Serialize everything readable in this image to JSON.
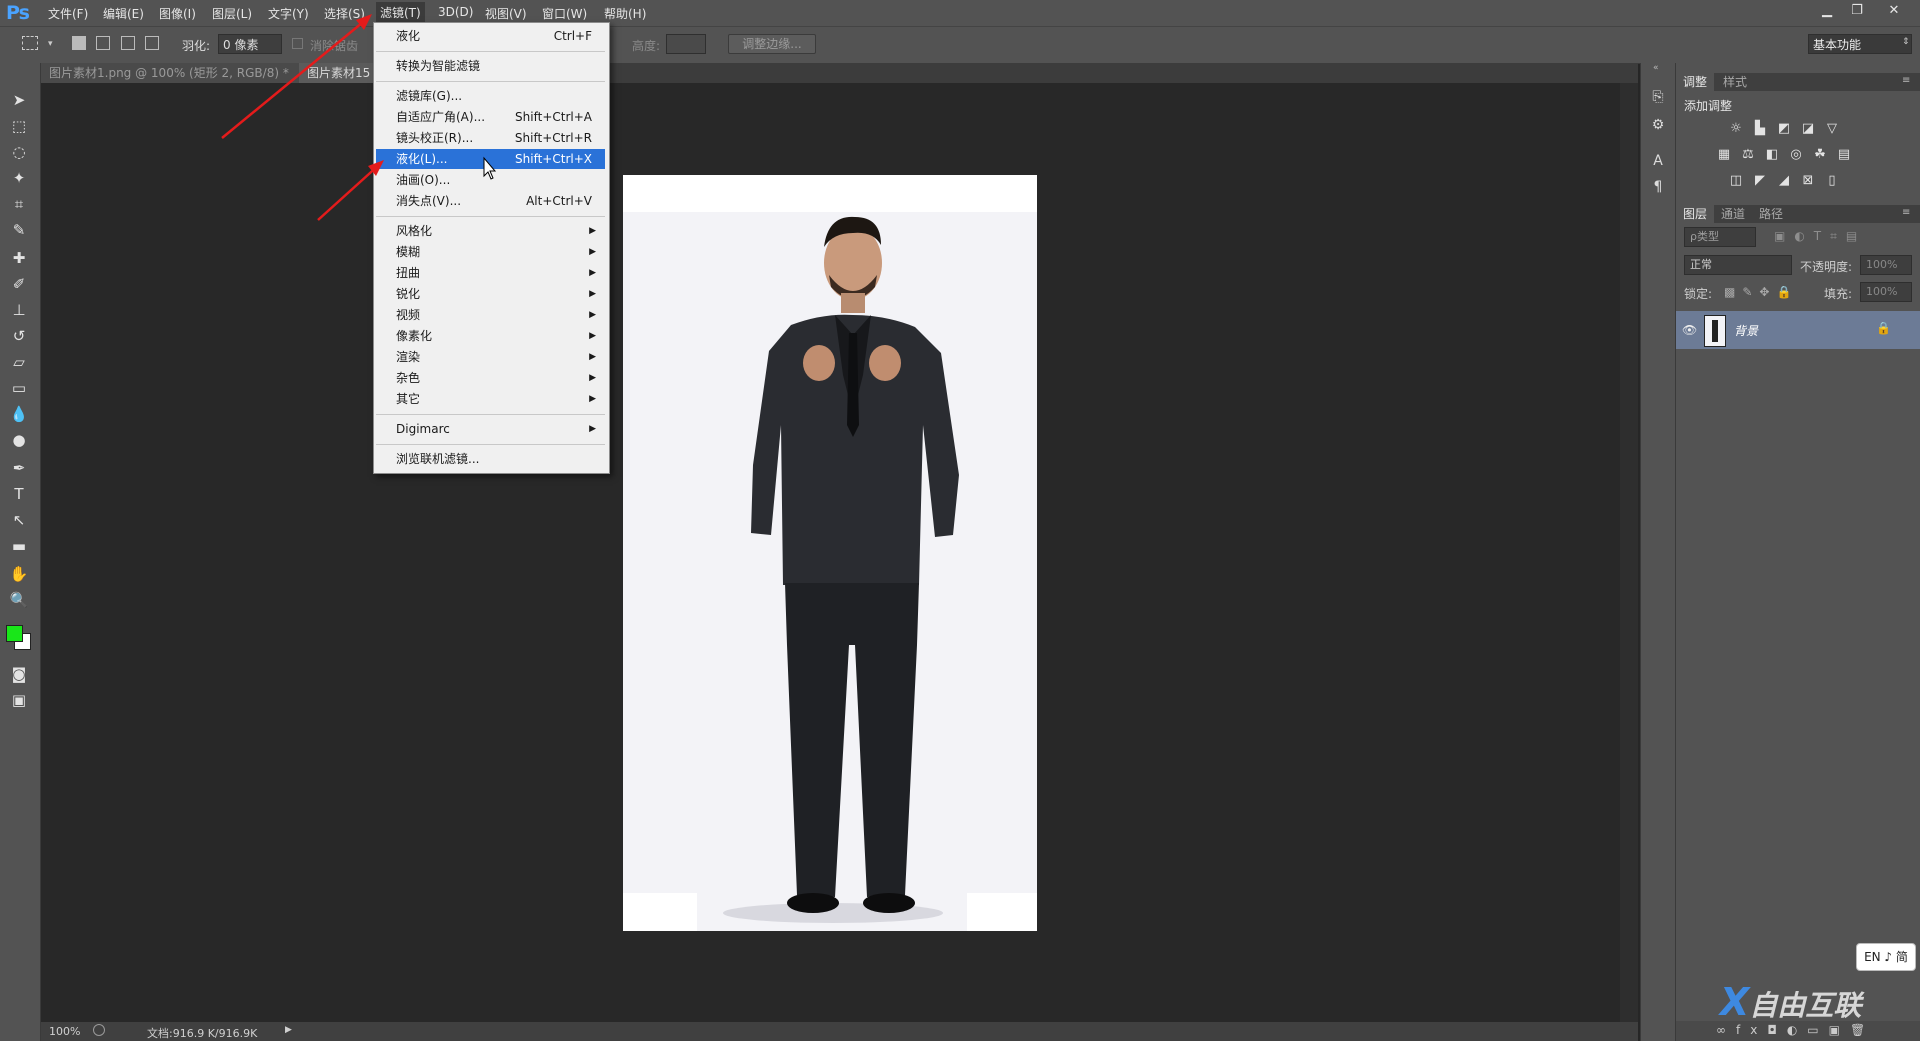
{
  "app": {
    "logo": "Ps"
  },
  "menubar": {
    "items": [
      "文件(F)",
      "编辑(E)",
      "图像(I)",
      "图层(L)",
      "文字(Y)",
      "选择(S)",
      "滤镜(T)",
      "3D(D)",
      "视图(V)",
      "窗口(W)",
      "帮助(H)"
    ],
    "active_index": 6
  },
  "options": {
    "feather_label": "羽化:",
    "feather_value": "0 像素",
    "antialias_label": "消除锯齿",
    "height_label": "高度:",
    "refine_edge": "调整边缘...",
    "workspace": "基本功能"
  },
  "tabs": [
    {
      "label": "图片素材1.png @ 100% (矩形 2, RGB/8) *",
      "close": "×"
    },
    {
      "label": "图片素材15"
    }
  ],
  "filter_menu": {
    "items": [
      {
        "label": "液化",
        "shortcut": "Ctrl+F"
      },
      {
        "sep": true
      },
      {
        "label": "转换为智能滤镜"
      },
      {
        "sep": true
      },
      {
        "label": "滤镜库(G)..."
      },
      {
        "label": "自适应广角(A)...",
        "shortcut": "Shift+Ctrl+A"
      },
      {
        "label": "镜头校正(R)...",
        "shortcut": "Shift+Ctrl+R"
      },
      {
        "label": "液化(L)...",
        "shortcut": "Shift+Ctrl+X",
        "highlighted": true
      },
      {
        "label": "油画(O)..."
      },
      {
        "label": "消失点(V)...",
        "shortcut": "Alt+Ctrl+V"
      },
      {
        "sep": true
      },
      {
        "label": "风格化",
        "submenu": true
      },
      {
        "label": "模糊",
        "submenu": true
      },
      {
        "label": "扭曲",
        "submenu": true
      },
      {
        "label": "锐化",
        "submenu": true
      },
      {
        "label": "视频",
        "submenu": true
      },
      {
        "label": "像素化",
        "submenu": true
      },
      {
        "label": "渲染",
        "submenu": true
      },
      {
        "label": "杂色",
        "submenu": true
      },
      {
        "label": "其它",
        "submenu": true
      },
      {
        "sep": true
      },
      {
        "label": "Digimarc",
        "submenu": true
      },
      {
        "sep": true
      },
      {
        "label": "浏览联机滤镜..."
      }
    ]
  },
  "panels": {
    "adjust_tabs": [
      "调整",
      "样式"
    ],
    "adjust_title": "添加调整",
    "layers_tabs": [
      "图层",
      "通道",
      "路径"
    ],
    "kind_filter": "ρ类型",
    "blend_mode": "正常",
    "opacity_label": "不透明度:",
    "opacity_value": "100%",
    "lock_label": "锁定:",
    "fill_label": "填充:",
    "fill_value": "100%",
    "layer_name": "背景"
  },
  "status": {
    "zoom": "100%",
    "doc": "文档:916.9 K/916.9K"
  },
  "ime": "EN ♪ 简",
  "watermark": "自由互联",
  "colors": {
    "foreground": "#19e619",
    "background": "#ffffff",
    "highlight": "#2a72d8",
    "arrow": "#e41b1b"
  }
}
